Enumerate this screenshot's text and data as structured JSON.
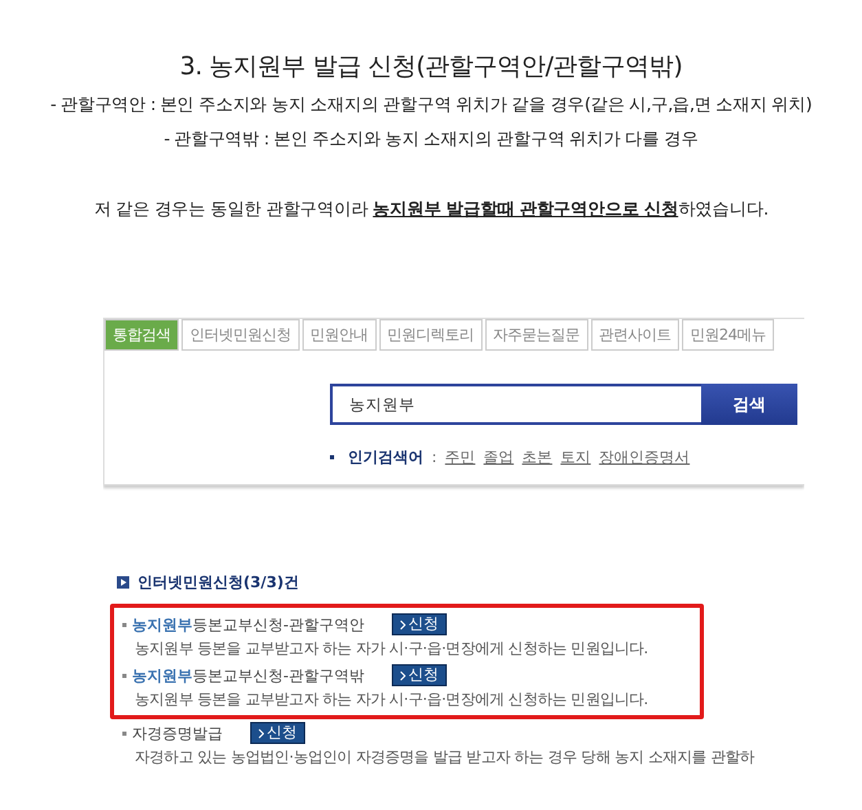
{
  "heading": "3. 농지원부 발급 신청(관할구역안/관할구역밖)",
  "notes": [
    "- 관할구역안 : 본인 주소지와 농지 소재지의 관할구역 위치가 같을 경우(같은 시,구,읍,면 소재지 위치)",
    "- 관할구역밖 : 본인 주소지와 농지 소재지의 관할구역 위치가 다를 경우"
  ],
  "remark": {
    "before": "저 같은 경우는 동일한 관할구역이라 ",
    "underlined": "농지원부 발급할때 관할구역안으로 신청",
    "after": "하였습니다."
  },
  "search_panel": {
    "tabs": [
      {
        "label": "통합검색",
        "selected": true
      },
      {
        "label": "인터넷민원신청",
        "selected": false
      },
      {
        "label": "민원안내",
        "selected": false
      },
      {
        "label": "민원디렉토리",
        "selected": false
      },
      {
        "label": "자주묻는질문",
        "selected": false
      },
      {
        "label": "관련사이트",
        "selected": false
      },
      {
        "label": "민원24메뉴",
        "selected": false
      }
    ],
    "query": "농지원부",
    "button": "검색",
    "popular_label": "인기검색어",
    "popular_sep": ":",
    "popular": [
      "주민",
      "졸업",
      "초본",
      "토지",
      "장애인증명서"
    ]
  },
  "results": {
    "header": "인터넷민원신청(3/3)건",
    "items": [
      {
        "title": "**농지원부**등본교부신청-관할구역안",
        "button": "신청",
        "description": "농지원부 등본을 교부받고자 하는 자가 시·구·읍·면장에게 신청하는 민원입니다.",
        "boxed": true
      },
      {
        "title": "**농지원부**등본교부신청-관할구역밖",
        "button": "신청",
        "description": "농지원부 등본을 교부받고자 하는 자가 시·구·읍·면장에게 신청하는 민원입니다.",
        "boxed": true
      },
      {
        "title": "자경증명발급",
        "button": "신청",
        "description": "자경하고 있는 농업법인·농업인이 자경증명을 발급 받고자 하는 경우 당해 농지 소재지를 관할하",
        "boxed": false
      }
    ]
  }
}
